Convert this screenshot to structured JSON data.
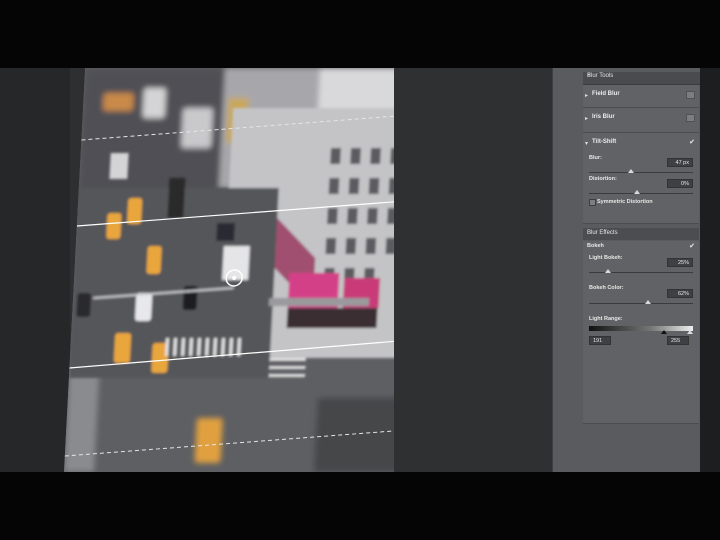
{
  "panel": {
    "title": "Blur Tools",
    "sections": [
      {
        "name": "Field Blur",
        "arrow": "▸"
      },
      {
        "name": "Iris Blur",
        "arrow": "▸"
      },
      {
        "name": "Tilt-Shift",
        "arrow": "▾"
      }
    ],
    "tilt_shift": {
      "blur_label": "Blur:",
      "blur_value": "47 px",
      "distortion_label": "Distortion:",
      "distortion_value": "0%",
      "symmetric_label": "Symmetric Distortion"
    },
    "effects": {
      "title": "Blur Effects",
      "bokeh_label": "Bokeh",
      "light_bokeh_label": "Light Bokeh:",
      "light_bokeh_value": "25%",
      "bokeh_color_label": "Bokeh Color:",
      "bokeh_color_value": "62%",
      "light_range_label": "Light Range:",
      "range_low": "191",
      "range_high": "255"
    }
  }
}
